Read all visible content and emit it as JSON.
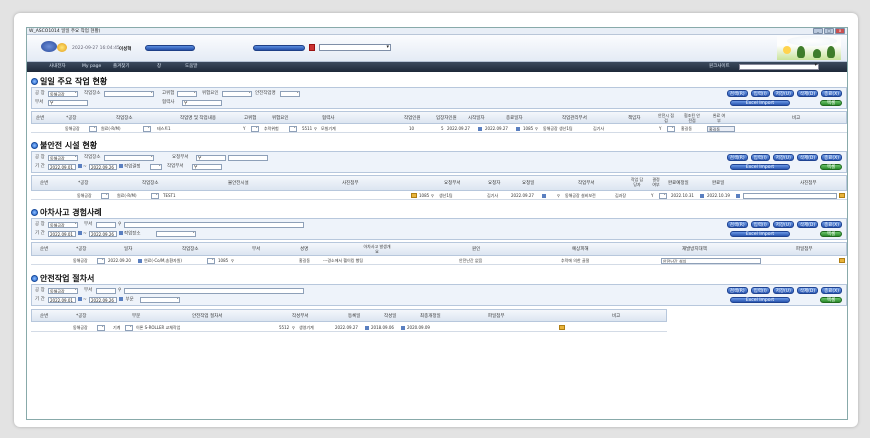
{
  "window": {
    "title": "W_ASCO1014 일일 주요 작업 현황)"
  },
  "top": {
    "datetime": "2022-09-27 16:04:45",
    "user": "이성혁",
    "pill1": "",
    "pill2": ""
  },
  "nav": {
    "items": [
      "사내전자",
      "My page",
      "즐겨찾기",
      "창",
      "도움말"
    ],
    "site_label": "원크사이트"
  },
  "buttons": {
    "search": "검색(R)",
    "input": "입력(I)",
    "save": "저장(U)",
    "delete": "삭제(D)",
    "close": "종료(X)",
    "excel_import": "Excel Import",
    "excel": "엑셀"
  },
  "sec1": {
    "title": "일일 주요 작업 현황",
    "filters": {
      "plant_label": "공 장",
      "plant_value": "동해공장",
      "workplace_label": "작업장소",
      "hazard_label": "고위험",
      "danger_label": "위험요인",
      "safety_label": "안전작업명",
      "dept_label": "부서",
      "partner_label": "협력사"
    },
    "headers": [
      "순번",
      "*공장",
      "작업장소",
      "작업명 및 작업내용",
      "고위험",
      "위험요인",
      "협력사",
      "작업인원",
      "입장자인원",
      "시작일자",
      "종료일자",
      "작업관리부서",
      "책임자",
      "안전시 점검",
      "협조된 안전점",
      "완료 여부",
      "비고"
    ],
    "row": {
      "plant": "동해공장",
      "place": "원료(-R/M)",
      "work": "테스트1",
      "hazard": "Y",
      "risk": "추락위험",
      "partner_code": "5511",
      "partner": "모빌기계",
      "workers": "10",
      "entrants": "5",
      "start": "2022.09.27",
      "end": "2022.09.27",
      "dept_code": "1085",
      "dept": "동해공장 생산1팀",
      "manager": "김기사",
      "check": "Y",
      "inspector": "홍길동",
      "done": "홍길동"
    }
  },
  "sec2": {
    "title": "불안전 시설 현황",
    "filters": {
      "plant_label": "공 장",
      "plant_value": "동해공장",
      "workplace_label": "작업장소",
      "req_dept_label": "요청부서",
      "period_label": "기 간",
      "from": "2022.09.01",
      "to": "2022.09.26",
      "result_label": "작업결정",
      "work_dept_label": "작업부서"
    },
    "headers": [
      "순번",
      "*공장",
      "작업장소",
      "불안전시설",
      "사진첨부",
      "요청부서",
      "요청자",
      "요청일",
      "작업부서",
      "작업 담당자",
      "결정 여부",
      "완료예정일",
      "완료일",
      "사진첨부"
    ],
    "row": {
      "plant": "동해공장",
      "place": "원료(-R/M)",
      "facility": "TEST1",
      "req_dept": "1085",
      "req_dept_name": "생산1팀",
      "requester": "김기사",
      "req_date": "2022.09.27",
      "work_dept": "동해공장 설비보전",
      "worker": "김과장",
      "decided": "Y",
      "due": "2022.10.31",
      "done": "2022.10.19"
    }
  },
  "sec3": {
    "title": "아차사고 경험사례",
    "filters": {
      "plant_label": "공 장",
      "plant_value": "동해공장",
      "dept_label": "부서",
      "period_label": "기 간",
      "from": "2022.09.01",
      "to": "2022.09.26",
      "workplace_label": "작업장소"
    },
    "headers": [
      "순번",
      "*공장",
      "일자",
      "작업장소",
      "부서",
      "성명",
      "아차사고 발생개요",
      "원인",
      "예상피해",
      "재발방지대책",
      "파일첨부"
    ],
    "row": {
      "plant": "동해공장",
      "date": "2022.09.20",
      "place": "연료(-Co/M,송환자원)",
      "dept": "1085",
      "name": "홍길동",
      "summary": "---경소에서 헬이킹 했팅",
      "cause": "안전난간 없음",
      "damage": "추락에 의한 골절",
      "measure": "안전난간 설치"
    }
  },
  "sec4": {
    "title": "안전작업 절차서",
    "filters": {
      "plant_label": "공 장",
      "plant_value": "동해공장",
      "dept_label": "부서",
      "period_label": "기 간",
      "from": "2022.09.01",
      "to": "2022.09.26",
      "part_label": "부문"
    },
    "headers": [
      "순번",
      "*공장",
      "부문",
      "안전작업 절차서",
      "작성부서",
      "등록일",
      "작성일",
      "최종개정일",
      "파일첨부",
      "비고"
    ],
    "row": {
      "plant": "동해공장",
      "part": "기계",
      "procedure": "이론 S-ROLLER 교체작업",
      "dept_code": "5512",
      "dept": "생영기계",
      "reg": "2022.09.27",
      "written": "2018.09.06",
      "revised": "2020.09.09"
    }
  }
}
